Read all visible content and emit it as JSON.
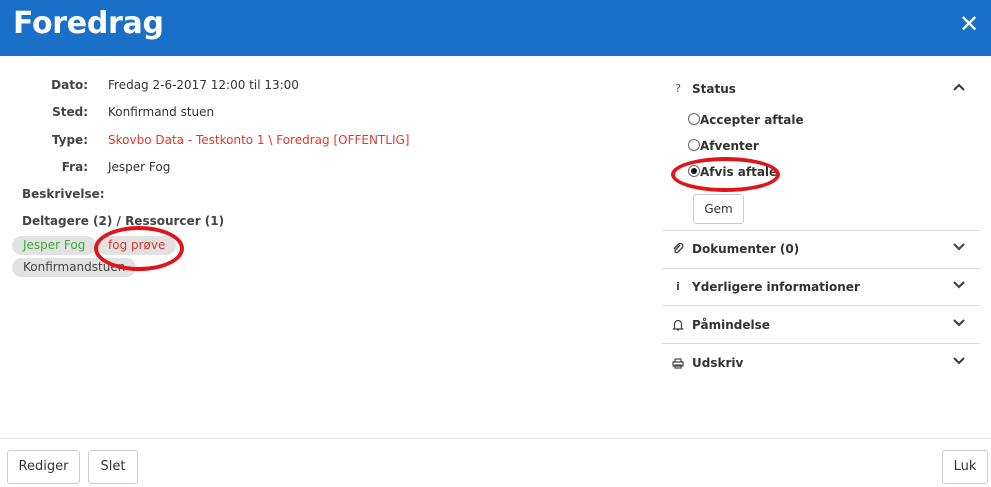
{
  "header": {
    "title": "Foredrag",
    "close_icon": "close-icon"
  },
  "details": {
    "dato_label": "Dato:",
    "dato_value": "Fredag 2-6-2017 12:00 til 13:00",
    "sted_label": "Sted:",
    "sted_value": "Konfirmand stuen",
    "type_label": "Type:",
    "type_value": "Skovbo Data - Testkonto 1 \\ Foredrag [OFFENTLIG]",
    "fra_label": "Fra:",
    "fra_value": "Jesper Fog",
    "beskrivelse_label": "Beskrivelse:",
    "deltagere_label": "Deltagere (2) / Ressourcer (1)"
  },
  "participants": [
    "Jesper Fog",
    "fog prøve"
  ],
  "resources": [
    "Konfirmandstuen"
  ],
  "status": {
    "title": "Status",
    "options": [
      "Accepter aftale",
      "Afventer",
      "Afvis aftale"
    ],
    "selected": "Afvis aftale",
    "save_label": "Gem"
  },
  "sections": [
    {
      "label": "Dokumenter (0)",
      "icon": "paperclip-icon"
    },
    {
      "label": "Yderligere informationer",
      "icon": "info-icon"
    },
    {
      "label": "Påmindelse",
      "icon": "bell-icon"
    },
    {
      "label": "Udskriv",
      "icon": "print-icon"
    }
  ],
  "footer": {
    "edit_label": "Rediger",
    "delete_label": "Slet",
    "close_label": "Luk"
  },
  "colors": {
    "header": "#1a6fc9",
    "accent_red": "#e03a2f",
    "participant_green": "#3aaa3a",
    "annotation": "#e0141b"
  }
}
